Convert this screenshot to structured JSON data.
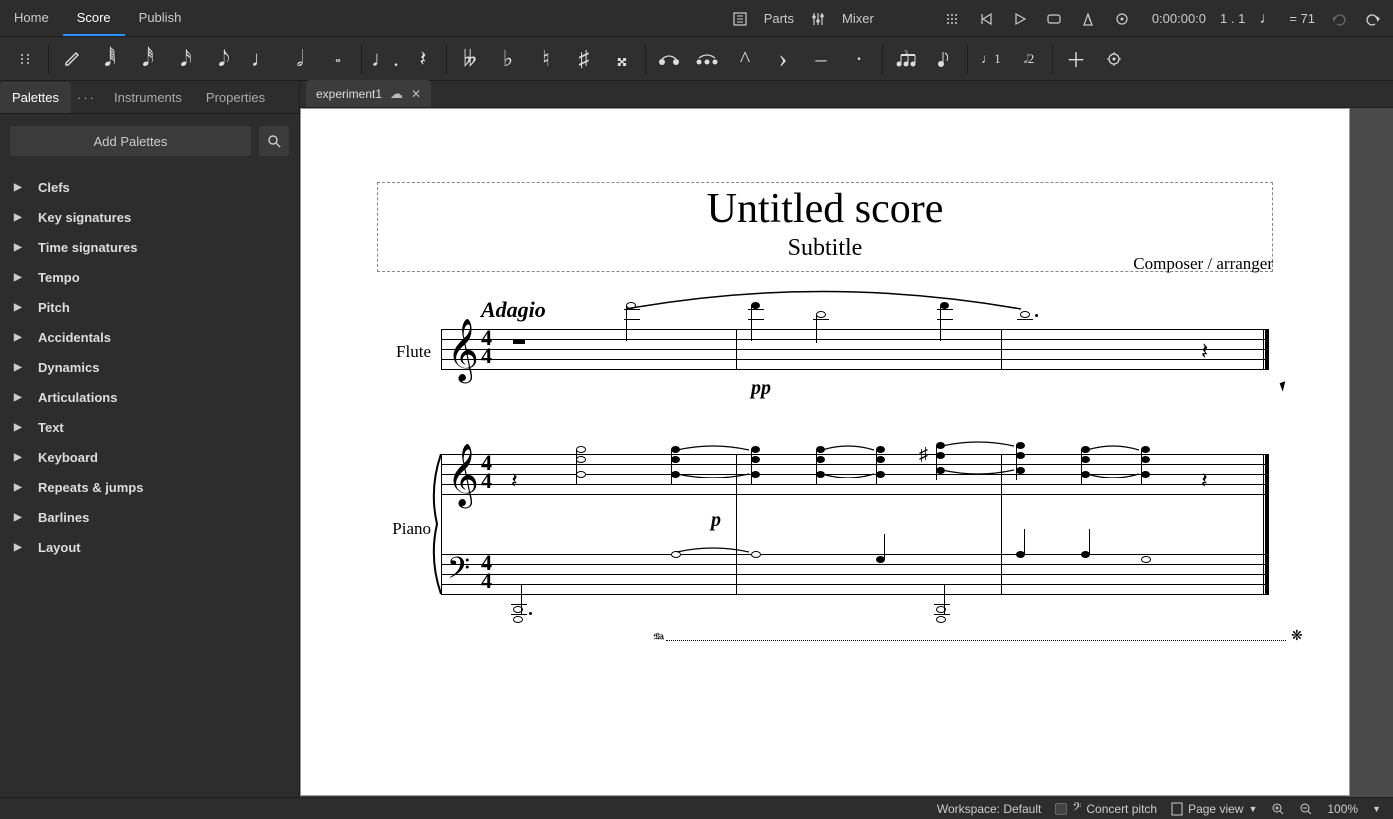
{
  "menu": {
    "home": "Home",
    "score": "Score",
    "publish": "Publish"
  },
  "topright": {
    "parts": "Parts",
    "mixer": "Mixer",
    "time": "0:00:00:0",
    "beat": "1 . 1",
    "tempo_eq": "= 71"
  },
  "doc_tab": {
    "name": "experiment1"
  },
  "panel": {
    "tabs": {
      "palettes": "Palettes",
      "instruments": "Instruments",
      "properties": "Properties"
    },
    "add_palettes": "Add Palettes",
    "items": [
      "Clefs",
      "Key signatures",
      "Time signatures",
      "Tempo",
      "Pitch",
      "Accidentals",
      "Dynamics",
      "Articulations",
      "Text",
      "Keyboard",
      "Repeats & jumps",
      "Barlines",
      "Layout"
    ]
  },
  "score": {
    "title": "Untitled score",
    "subtitle": "Subtitle",
    "composer": "Composer / arranger",
    "tempo": "Adagio",
    "instr1": "Flute",
    "instr2": "Piano",
    "dyn_pp": "pp",
    "dyn_p": "p",
    "ped": "𝆮",
    "rel": "❋"
  },
  "status": {
    "workspace": "Workspace: Default",
    "concert": "Concert pitch",
    "pageview": "Page view",
    "zoom": "100%"
  }
}
